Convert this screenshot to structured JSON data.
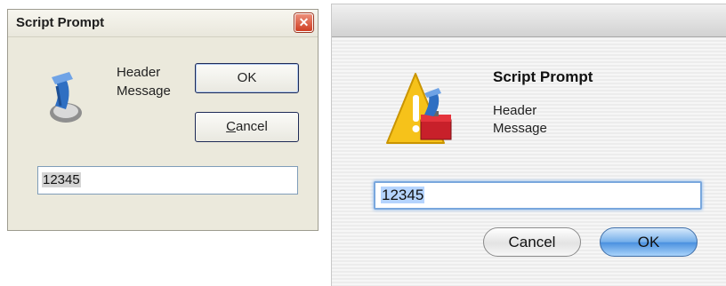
{
  "windows_dialog": {
    "title": "Script Prompt",
    "close_glyph": "✕",
    "message_lines": [
      "Header",
      "Message"
    ],
    "ok_label": "OK",
    "cancel_prefix": "C",
    "cancel_rest": "ancel",
    "input_value": "12345",
    "icon": "script-tool-icon"
  },
  "mac_dialog": {
    "title": "Script Prompt",
    "message_lines": [
      "Header",
      "Message"
    ],
    "input_value": "12345",
    "cancel_label": "Cancel",
    "ok_label": "OK",
    "icon": "warning-toolbox-icon"
  },
  "colors": {
    "win_close_red": "#cf3f24",
    "mac_ok_blue": "#4a90df",
    "mac_focus_blue": "#79a7dd"
  }
}
